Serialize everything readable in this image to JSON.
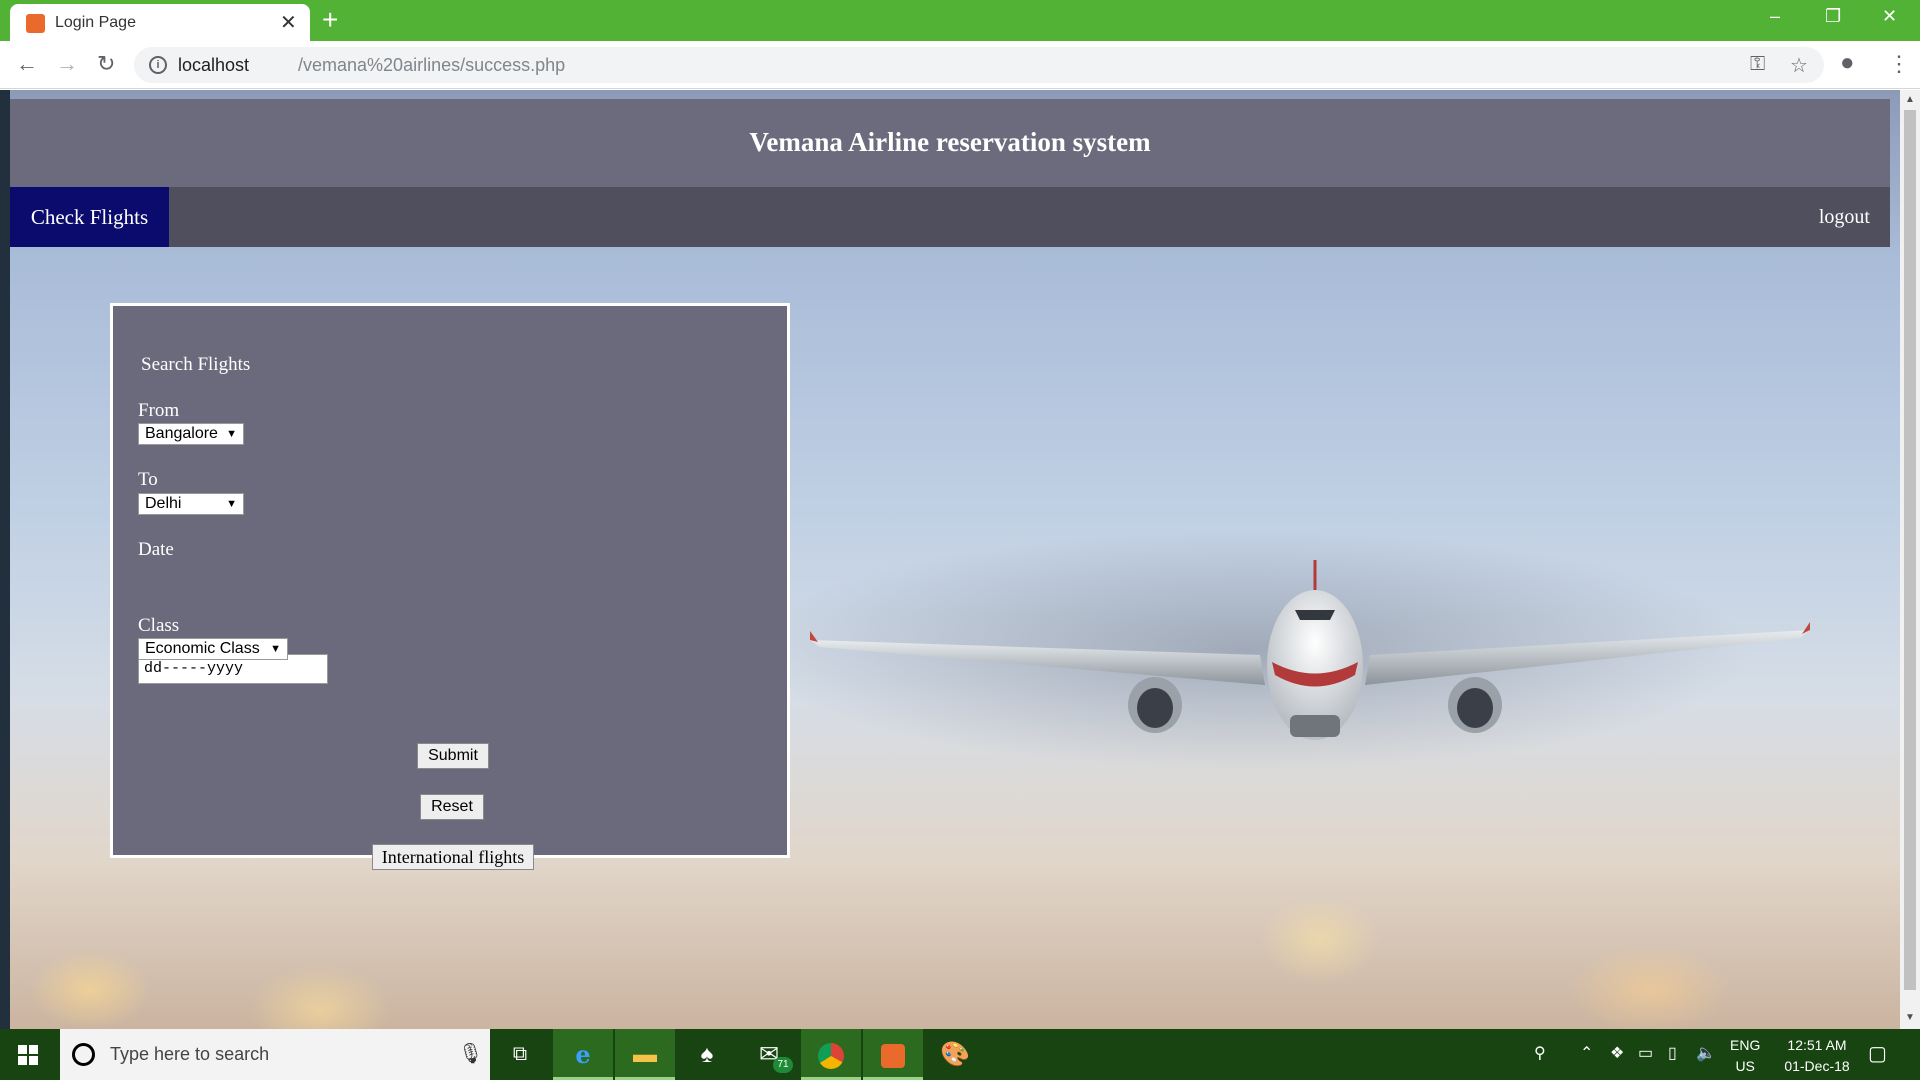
{
  "browser": {
    "tab_title": "Login Page",
    "tab_close": "✕",
    "new_tab": "+",
    "url_host": "localhost",
    "url_path": "/vemana%20airlines/success.php",
    "window_controls": [
      "–",
      "❐",
      "✕"
    ]
  },
  "site": {
    "title": "Vemana Airline reservation system",
    "nav": {
      "check_flights": "Check Flights",
      "logout": "logout"
    }
  },
  "form": {
    "heading": "Search Flights",
    "from_label": "From",
    "from_value": "Bangalore",
    "to_label": "To",
    "to_value": "Delhi",
    "date_label": "Date",
    "date_placeholder": "dd-----yyyy",
    "class_label": "Class",
    "class_value": "Economic Class",
    "submit_label": "Submit",
    "reset_label": "Reset",
    "international_label": "International flights"
  },
  "taskbar": {
    "search_placeholder": "Type here to search",
    "language": "ENG",
    "region": "US",
    "time": "12:51 AM",
    "date": "01-Dec-18",
    "mail_badge": "71"
  },
  "icons": [
    "back-icon",
    "forward-icon",
    "reload-icon",
    "info-icon",
    "key-icon",
    "star-icon",
    "account-icon",
    "menu-icon",
    "windows-start-icon",
    "cortana-icon",
    "mic-icon",
    "task-view-icon",
    "edge-icon",
    "file-explorer-icon",
    "solitaire-icon",
    "mail-icon",
    "chrome-icon",
    "xampp-icon",
    "paint-icon",
    "people-icon",
    "notification-icon"
  ],
  "colors": {
    "tab_strip": "#52b236",
    "header": "#6b6b7d",
    "navbar": "#4f4f5e",
    "nav_active": "#0b0b6e",
    "panel": "#6a6a7c",
    "taskbar": "#184411"
  }
}
